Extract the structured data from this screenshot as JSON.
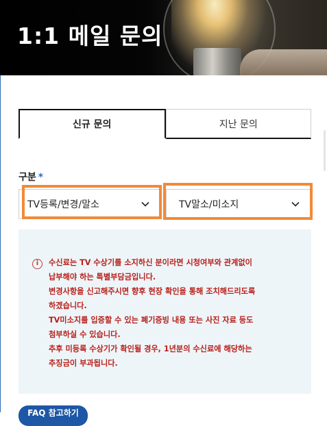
{
  "header": {
    "title": "1:1 메일 문의"
  },
  "tabs": [
    {
      "label": "신규 문의",
      "active": true
    },
    {
      "label": "지난 문의",
      "active": false
    }
  ],
  "form": {
    "category_label": "구분",
    "required_mark": "*",
    "select_primary": {
      "value": "TV등록/변경/말소"
    },
    "select_secondary": {
      "value": "TV말소/미소지"
    }
  },
  "notice": {
    "icon": "info-icon",
    "lines": [
      "수신료는 TV 수상기를 소지하신 분이라면 시청여부와 관계없이",
      "납부해야 하는 특별부담금입니다.",
      "변경사항을 신고해주시면 향후 현장 확인을 통해 조치해드리도록",
      "하겠습니다.",
      "TV미소지를 입증할 수 있는 폐기증빙 내용 또는 사진 자료 등도",
      "첨부하실 수 있습니다.",
      "추후 미등록 수상기가 확인될 경우, 1년분의 수신료에 해당하는",
      "추징금이 부과됩니다."
    ]
  },
  "faq_button": {
    "label": "FAQ 참고하기"
  },
  "colors": {
    "accent": "#1d57a6",
    "highlight": "#f08a3a",
    "notice_text": "#b8201a",
    "notice_bg": "#eef5f9"
  }
}
